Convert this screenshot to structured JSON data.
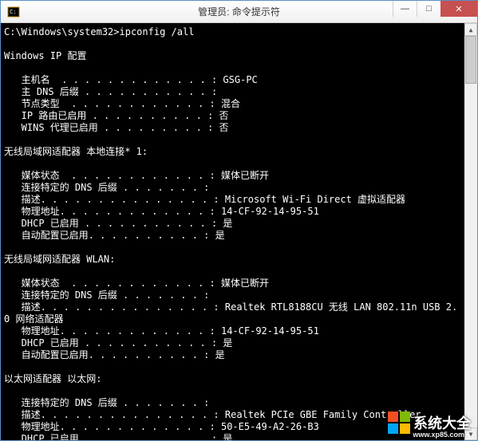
{
  "titlebar": {
    "title": "管理员: 命令提示符",
    "minimize": "—",
    "maximize": "□",
    "close": "✕"
  },
  "terminal": {
    "prompt": "C:\\Windows\\system32>",
    "command": "ipconfig /all",
    "sections": {
      "header": "Windows IP 配置",
      "host": {
        "lines": [
          {
            "label": "   主机名  . . . . . . . . . . . . . : ",
            "value": "GSG-PC"
          },
          {
            "label": "   主 DNS 后缀 . . . . . . . . . . . : ",
            "value": ""
          },
          {
            "label": "   节点类型  . . . . . . . . . . . . : ",
            "value": "混合"
          },
          {
            "label": "   IP 路由已启用 . . . . . . . . . . : ",
            "value": "否"
          },
          {
            "label": "   WINS 代理已启用 . . . . . . . . . : ",
            "value": "否"
          }
        ]
      },
      "wlan_local": {
        "title": "无线局域网适配器 本地连接* 1:",
        "lines": [
          {
            "label": "   媒体状态  . . . . . . . . . . . . : ",
            "value": "媒体已断开"
          },
          {
            "label": "   连接特定的 DNS 后缀 . . . . . . . : ",
            "value": ""
          },
          {
            "label": "   描述. . . . . . . . . . . . . . . : ",
            "value": "Microsoft Wi-Fi Direct 虚拟适配器"
          },
          {
            "label": "   物理地址. . . . . . . . . . . . . : ",
            "value": "14-CF-92-14-95-51"
          },
          {
            "label": "   DHCP 已启用 . . . . . . . . . . . : ",
            "value": "是"
          },
          {
            "label": "   自动配置已启用. . . . . . . . . . : ",
            "value": "是"
          }
        ]
      },
      "wlan": {
        "title": "无线局域网适配器 WLAN:",
        "lines": [
          {
            "label": "   媒体状态  . . . . . . . . . . . . : ",
            "value": "媒体已断开"
          },
          {
            "label": "   连接特定的 DNS 后缀 . . . . . . . : ",
            "value": ""
          },
          {
            "label": "   描述. . . . . . . . . . . . . . . : ",
            "value": "Realtek RTL8188CU 无线 LAN 802.11n USB 2."
          },
          {
            "label": "0 网络适配器",
            "value": ""
          },
          {
            "label": "   物理地址. . . . . . . . . . . . . : ",
            "value": "14-CF-92-14-95-51"
          },
          {
            "label": "   DHCP 已启用 . . . . . . . . . . . : ",
            "value": "是"
          },
          {
            "label": "   自动配置已启用. . . . . . . . . . : ",
            "value": "是"
          }
        ]
      },
      "ethernet": {
        "title": "以太网适配器 以太网:",
        "lines": [
          {
            "label": "   连接特定的 DNS 后缀 . . . . . . . : ",
            "value": ""
          },
          {
            "label": "   描述. . . . . . . . . . . . . . . : ",
            "value": "Realtek PCIe GBE Family Controller"
          },
          {
            "label": "   物理地址. . . . . . . . . . . . . : ",
            "value": "50-E5-49-A2-26-B3"
          },
          {
            "label": "   DHCP 已启用 . . . . . . . . . . . : ",
            "value": "是"
          }
        ]
      }
    }
  },
  "watermark": {
    "text": "系统大全",
    "url": "www.xp85.com"
  }
}
